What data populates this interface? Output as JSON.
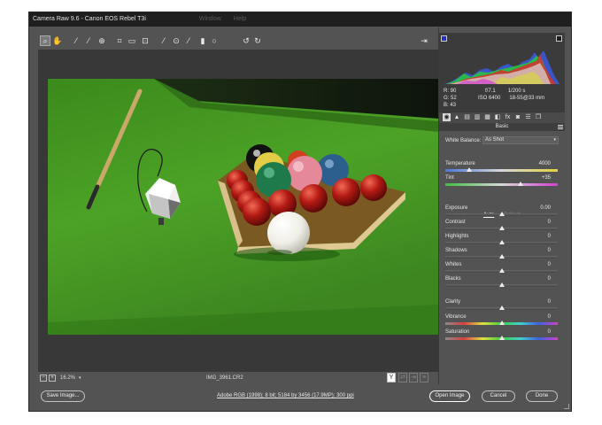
{
  "window": {
    "title": "Camera Raw 9.6  -  Canon EOS Rebel T3i",
    "menu_ghost": [
      "Window",
      "Help"
    ]
  },
  "toolbar": {
    "tools": [
      {
        "name": "zoom-tool-icon",
        "glyph": "⌕",
        "selected": true
      },
      {
        "name": "hand-tool-icon",
        "glyph": "✋",
        "selected": false
      },
      {
        "name": "white-balance-tool-icon",
        "glyph": "⁄",
        "selected": false
      },
      {
        "name": "color-sampler-tool-icon",
        "glyph": "⁄",
        "selected": false
      },
      {
        "name": "targeted-adjustment-tool-icon",
        "glyph": "⊕",
        "selected": false
      },
      {
        "name": "crop-tool-icon",
        "glyph": "⌗",
        "selected": false
      },
      {
        "name": "straighten-tool-icon",
        "glyph": "▭",
        "selected": false
      },
      {
        "name": "transform-tool-icon",
        "glyph": "⊡",
        "selected": false
      },
      {
        "name": "spot-removal-tool-icon",
        "glyph": "⁄",
        "selected": false
      },
      {
        "name": "red-eye-removal-icon",
        "glyph": "⊙",
        "selected": false
      },
      {
        "name": "adjustment-brush-icon",
        "glyph": "⁄",
        "selected": false
      },
      {
        "name": "graduated-filter-icon",
        "glyph": "▮",
        "selected": false
      },
      {
        "name": "radial-filter-icon",
        "glyph": "○",
        "selected": false
      },
      {
        "name": "rotate-ccw-icon",
        "glyph": "↺",
        "selected": false
      },
      {
        "name": "rotate-cw-icon",
        "glyph": "↻",
        "selected": false
      }
    ],
    "open_preferences_glyph": "⇥"
  },
  "bottom": {
    "zoom_minus": "−",
    "zoom_plus": "+",
    "zoom": "16.2%",
    "zoom_caret": "▾",
    "filename": "IMG_3961.CR2",
    "view_y": "Y",
    "view_swap": "⇄",
    "view_copy": "⇥",
    "view_grid": "≡"
  },
  "readout": {
    "r": "R:  90",
    "g": "G:  52",
    "b": "B:  43",
    "aperture": "f/7.1",
    "shutter": "1/200 s",
    "iso": "ISO 6400",
    "lens": "18-55@33 mm"
  },
  "panel": {
    "tabs": [
      "◉",
      "▲",
      "▤",
      "▥",
      "▦",
      "◧",
      "fx",
      "◙",
      "☰",
      "❐"
    ],
    "header": "Basic",
    "white_balance_label": "White Balance:",
    "white_balance_value": "As Shot",
    "caret": "▾",
    "auto": "Auto",
    "default": "Default"
  },
  "sliders": [
    {
      "key": "temperature",
      "label": "Temperature",
      "value": "4000",
      "pos": 0.21,
      "grad": "linear-gradient(90deg,#4a78d8,#d8d8d8 50%,#e4d23c)"
    },
    {
      "key": "tint",
      "label": "Tint",
      "value": "+35",
      "pos": 0.67,
      "grad": "linear-gradient(90deg,#3fbf3f,#d8d8d8 50%,#d33fd3)"
    },
    {
      "key": "exposure",
      "label": "Exposure",
      "value": "0.00",
      "pos": 0.5
    },
    {
      "key": "contrast",
      "label": "Contrast",
      "value": "0",
      "pos": 0.5
    },
    {
      "key": "highlights",
      "label": "Highlights",
      "value": "0",
      "pos": 0.5
    },
    {
      "key": "shadows",
      "label": "Shadows",
      "value": "0",
      "pos": 0.5
    },
    {
      "key": "whites",
      "label": "Whites",
      "value": "0",
      "pos": 0.5
    },
    {
      "key": "blacks",
      "label": "Blacks",
      "value": "0",
      "pos": 0.5
    },
    {
      "key": "clarity",
      "label": "Clarity",
      "value": "0",
      "pos": 0.5
    },
    {
      "key": "vibrance",
      "label": "Vibrance",
      "value": "0",
      "pos": 0.5,
      "grad": "linear-gradient(90deg,#8a8a8a,#d84040,#e0e040,#40d040,#40d0d0,#4060e0,#d040d0)"
    },
    {
      "key": "saturation",
      "label": "Saturation",
      "value": "0",
      "pos": 0.5,
      "grad": "linear-gradient(90deg,#8a8a8a,#d84040,#e0e040,#40d040,#40d0d0,#4060e0,#d040d0)"
    }
  ],
  "footer": {
    "save": "Save Image...",
    "info": "Adobe RGB (1998); 8 bit; 5184 by 3456 (17.9MP); 300 ppi",
    "open": "Open Image",
    "cancel": "Cancel",
    "done": "Done"
  }
}
